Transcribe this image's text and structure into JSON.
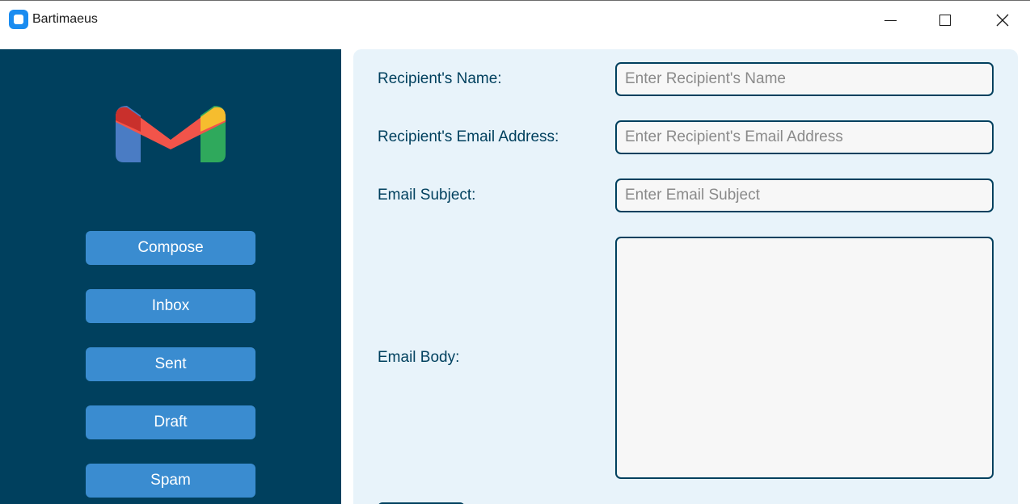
{
  "window": {
    "title": "Bartimaeus"
  },
  "sidebar": {
    "logo": "gmail-logo-icon",
    "items": [
      {
        "label": "Compose"
      },
      {
        "label": "Inbox"
      },
      {
        "label": "Sent"
      },
      {
        "label": "Draft"
      },
      {
        "label": "Spam"
      }
    ]
  },
  "form": {
    "recipient_name": {
      "label": "Recipient's Name:",
      "placeholder": "Enter Recipient's Name",
      "value": ""
    },
    "recipient_email": {
      "label": "Recipient's Email Address:",
      "placeholder": "Enter Recipient's Email Address",
      "value": ""
    },
    "subject": {
      "label": "Email Subject:",
      "placeholder": "Enter Email Subject",
      "value": ""
    },
    "body": {
      "label": "Email Body:",
      "value": ""
    }
  },
  "colors": {
    "sidebar_bg": "#00405e",
    "nav_button": "#3a8cd0",
    "panel_bg": "#e8f3fa",
    "field_border": "#00405e"
  }
}
